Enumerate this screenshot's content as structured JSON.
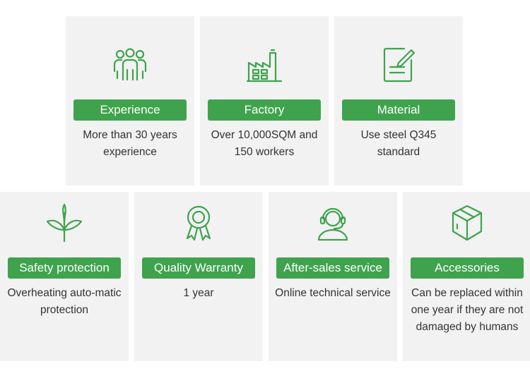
{
  "colors": {
    "accent": "#3fa34d",
    "icon": "#3fa34d",
    "card_bg": "#f2f2f2",
    "text": "#333333"
  },
  "cards": [
    {
      "title": "Experience",
      "description": "More than 30 years experience",
      "icon": "people-group-icon"
    },
    {
      "title": "Factory",
      "description": "Over 10,000SQM and 150 workers",
      "icon": "factory-icon"
    },
    {
      "title": "Material",
      "description": "Use steel Q345 standard",
      "icon": "document-edit-icon"
    },
    {
      "title": "Safety protection",
      "description": "Overheating auto-matic protection",
      "icon": "plant-sprout-icon"
    },
    {
      "title": "Quality Warranty",
      "description": "1 year",
      "icon": "award-ribbon-icon"
    },
    {
      "title": "After-sales service",
      "description": "Online technical service",
      "icon": "headset-support-icon"
    },
    {
      "title": "Accessories",
      "description": "Can be replaced within one year if they are not damaged by humans",
      "icon": "package-box-icon"
    }
  ]
}
